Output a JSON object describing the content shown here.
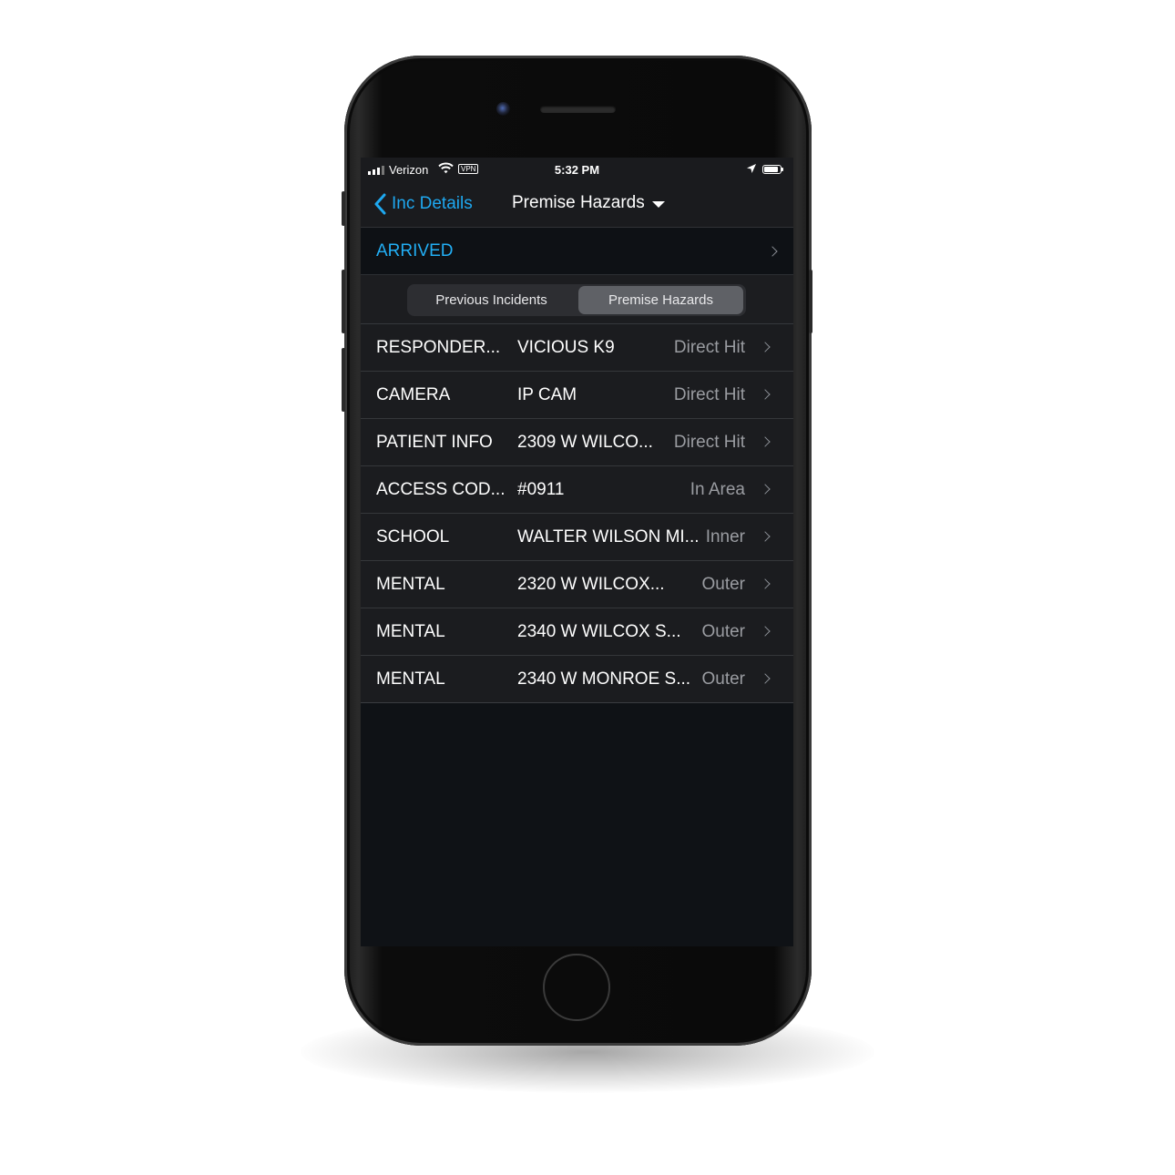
{
  "status_bar": {
    "carrier": "Verizon",
    "vpn_label": "VPN",
    "time": "5:32 PM"
  },
  "nav": {
    "back_label": "Inc Details",
    "title": "Premise Hazards"
  },
  "status": {
    "label": "ARRIVED"
  },
  "segments": {
    "left": "Previous Incidents",
    "right": "Premise Hazards",
    "selected": "Premise Hazards"
  },
  "hazards": [
    {
      "type": "RESPONDER...",
      "description": "VICIOUS K9",
      "proximity": "Direct Hit"
    },
    {
      "type": "CAMERA",
      "description": "IP CAM",
      "proximity": "Direct Hit"
    },
    {
      "type": "PATIENT INFO",
      "description": "2309 W WILCO...",
      "proximity": "Direct Hit"
    },
    {
      "type": "ACCESS COD...",
      "description": "#0911",
      "proximity": "In Area"
    },
    {
      "type": "SCHOOL",
      "description": "WALTER WILSON MI...",
      "proximity": "Inner"
    },
    {
      "type": "MENTAL",
      "description": "2320 W WILCOX...",
      "proximity": "Outer"
    },
    {
      "type": "MENTAL",
      "description": "2340 W WILCOX S...",
      "proximity": "Outer"
    },
    {
      "type": "MENTAL",
      "description": "2340 W MONROE S...",
      "proximity": "Outer"
    }
  ],
  "colors": {
    "accent": "#22aef4",
    "background": "#0f1216",
    "row_background": "#1b1c1f",
    "secondary_text": "#9a9ca1"
  }
}
